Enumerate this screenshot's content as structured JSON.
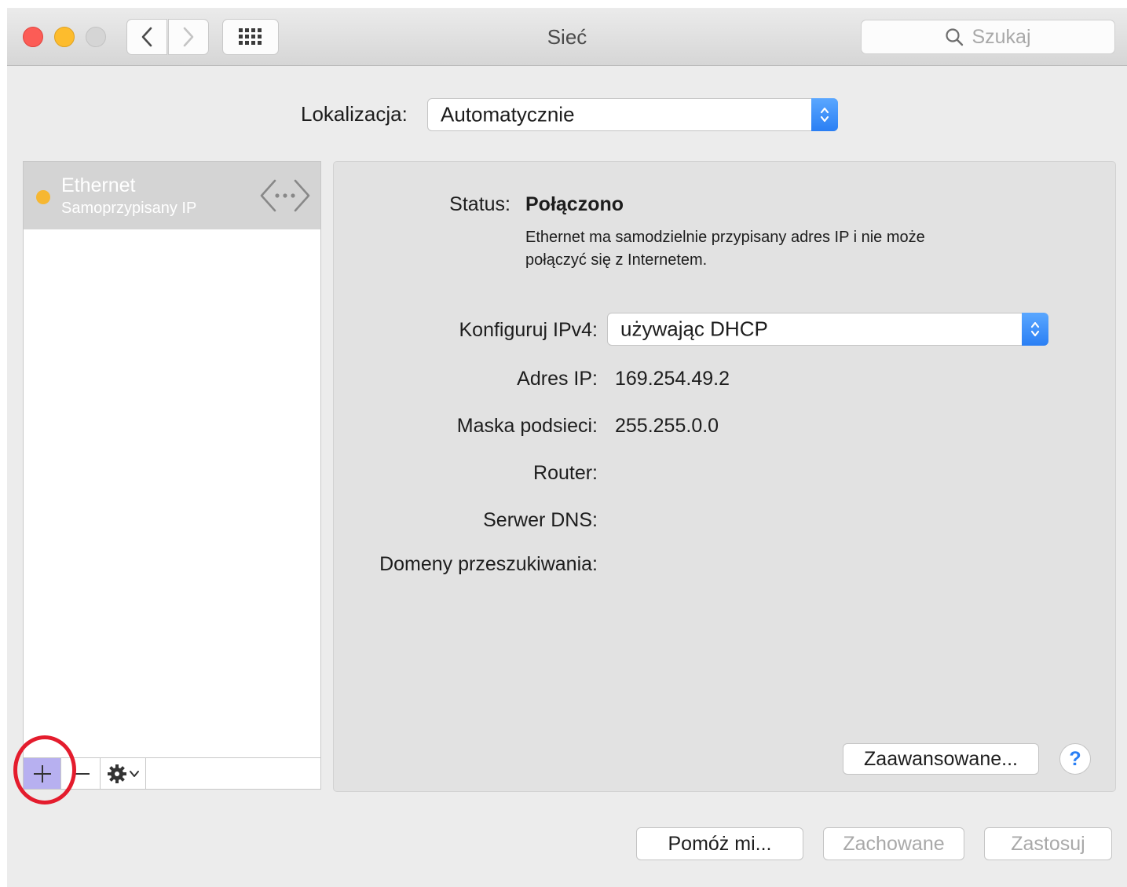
{
  "window": {
    "title": "Sieć",
    "search_placeholder": "Szukaj"
  },
  "icons": {
    "back": "chevron-left-icon",
    "forward": "chevron-right-icon",
    "grid": "grid-icon",
    "search": "search-icon",
    "ethernet": "ethernet-icon",
    "stepper": "stepper-icon",
    "add": "plus-icon",
    "remove": "minus-icon",
    "gear": "gear-icon"
  },
  "location": {
    "label": "Lokalizacja:",
    "value": "Automatycznie"
  },
  "services": [
    {
      "name": "Ethernet",
      "subtitle": "Samoprzypisany IP",
      "status_color": "#f6b732"
    }
  ],
  "detail": {
    "status_label": "Status:",
    "status_value": "Połączono",
    "status_description": "Ethernet ma samodzielnie przypisany adres IP i nie może połączyć się z Internetem.",
    "configure_label": "Konfiguruj IPv4:",
    "configure_value": "używając DHCP",
    "ip_label": "Adres IP:",
    "ip_value": "169.254.49.2",
    "mask_label": "Maska podsieci:",
    "mask_value": "255.255.0.0",
    "router_label": "Router:",
    "dns_label": "Serwer DNS:",
    "search_domains_label": "Domeny przeszukiwania:",
    "advanced_button": "Zaawansowane...",
    "help_button": "?"
  },
  "footer": {
    "help_me": "Pomóż mi...",
    "saved": "Zachowane",
    "apply": "Zastosuj"
  },
  "colors": {
    "accent": "#2a7ff4",
    "highlight_ring": "#e41c2d",
    "add_button_highlight": "#b7b0f0"
  }
}
